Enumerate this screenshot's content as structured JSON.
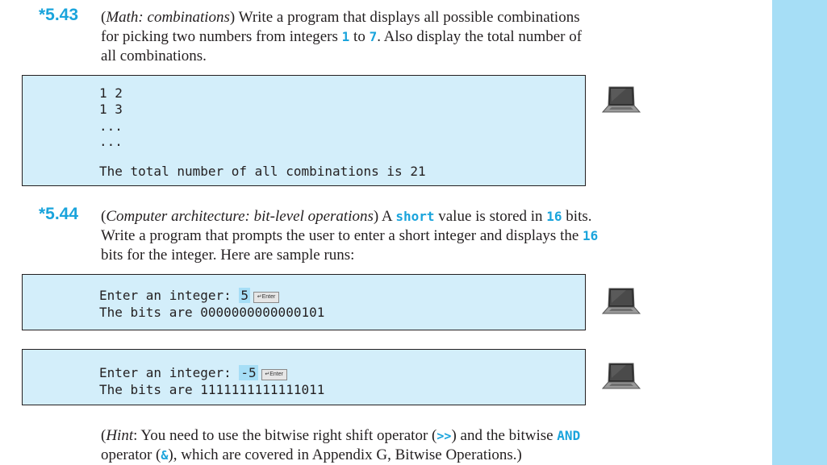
{
  "exercises": [
    {
      "number": "*5.43",
      "topic": "Math: combinations",
      "text_1": " Write a program that displays all possible combinations",
      "text_2a": "for picking two numbers from integers ",
      "num_low": "1",
      "text_2b": " to ",
      "num_high": "7",
      "text_2c": ". Also display the total number of",
      "text_3": "all combinations."
    },
    {
      "number": "*5.44",
      "topic": "Computer architecture: bit-level operations",
      "text_1a": " A ",
      "kw_short": "short",
      "text_1b": " value is stored in ",
      "bits_count": "16",
      "text_1c": " bits.",
      "text_2a": "Write a program that prompts the user to enter a short integer and displays the ",
      "bits_count_2": "16",
      "text_3": "bits for the integer. Here are sample runs:"
    }
  ],
  "console_1": {
    "lines": [
      "1 2",
      "1 3",
      "...",
      "...",
      "",
      "The total number of all combinations is 21"
    ]
  },
  "console_2": {
    "prompt": "Enter an integer: ",
    "input": "5",
    "enter_label": "↵Enter",
    "output": "The bits are 0000000000000101"
  },
  "console_3": {
    "prompt": "Enter an integer: ",
    "input": "-5",
    "enter_label": "↵Enter",
    "output": "The bits are 1111111111111011"
  },
  "hint": {
    "label": "Hint",
    "text_1a": ": You need to use the bitwise right shift operator (",
    "op_shift": ">>",
    "text_1b": ") and the bitwise ",
    "kw_and": "AND",
    "text_2a": "operator (",
    "op_and": "&",
    "text_2b": "), which are covered in Appendix G, Bitwise Operations.)"
  },
  "colors": {
    "accent": "#1aa4dc",
    "console_bg": "#d3eefa",
    "sidebar_bg": "#a6def6"
  },
  "icons": [
    "laptop-icon"
  ]
}
